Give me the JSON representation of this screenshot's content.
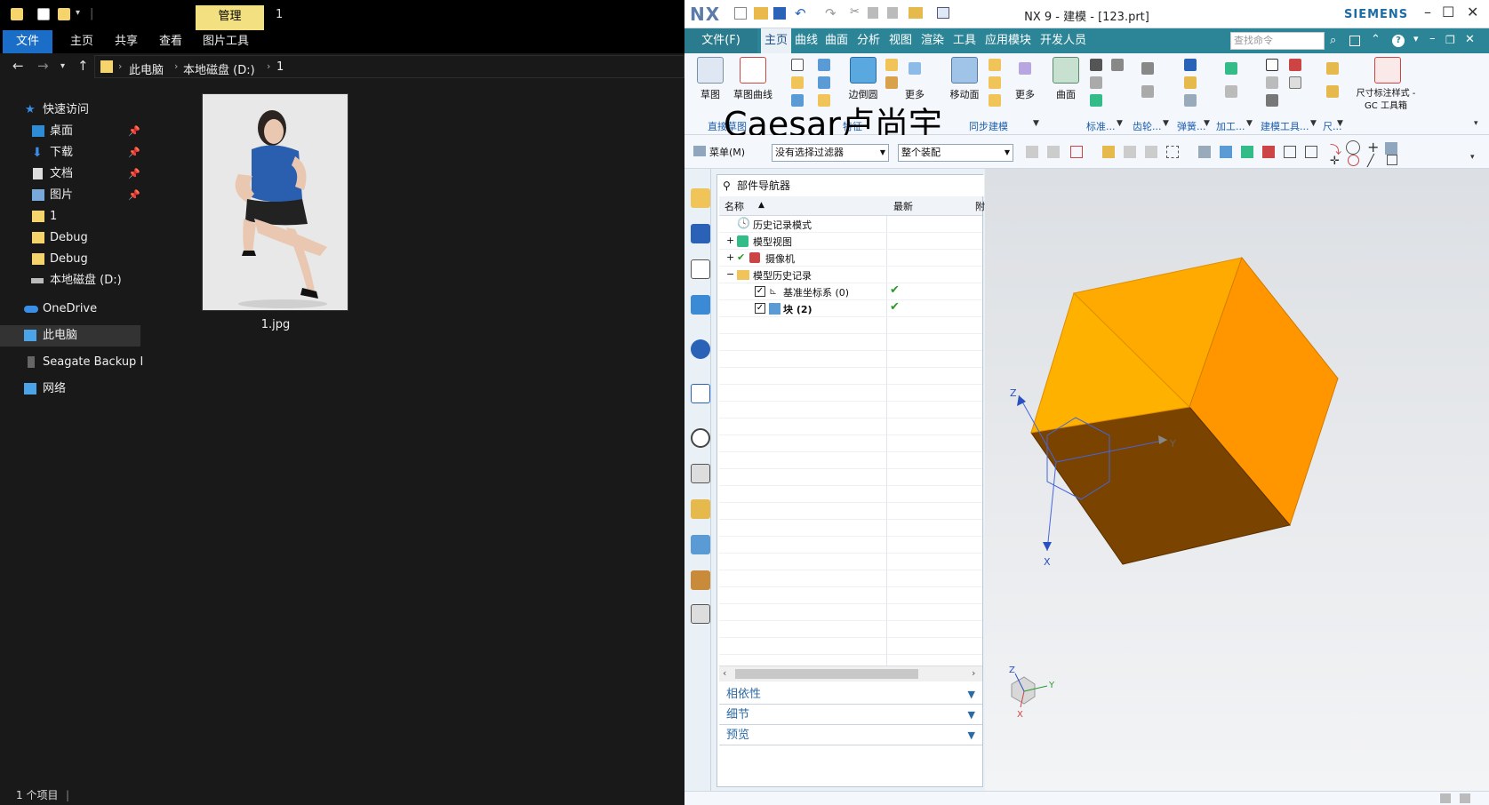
{
  "explorer": {
    "manage_tab": "管理",
    "window_title": "1",
    "tabs": [
      "文件",
      "主页",
      "共享",
      "查看",
      "图片工具"
    ],
    "breadcrumb": [
      "此电脑",
      "本地磁盘 (D:)",
      "1"
    ],
    "nav": [
      {
        "label": "快速访问",
        "icon": "star-icon"
      },
      {
        "label": "桌面",
        "icon": "desktop-icon",
        "pinned": true
      },
      {
        "label": "下载",
        "icon": "download-icon",
        "pinned": true
      },
      {
        "label": "文档",
        "icon": "document-icon",
        "pinned": true
      },
      {
        "label": "图片",
        "icon": "pictures-icon",
        "pinned": true
      },
      {
        "label": "1",
        "icon": "folder-icon"
      },
      {
        "label": "Debug",
        "icon": "folder-icon"
      },
      {
        "label": "Debug",
        "icon": "folder-icon"
      },
      {
        "label": "本地磁盘 (D:)",
        "icon": "drive-icon"
      },
      {
        "label": "OneDrive",
        "icon": "cloud-icon"
      },
      {
        "label": "此电脑",
        "icon": "computer-icon",
        "selected": true
      },
      {
        "label": "Seagate Backup Plu",
        "icon": "external-drive-icon"
      },
      {
        "label": "网络",
        "icon": "network-icon"
      }
    ],
    "file": {
      "name": "1.jpg"
    },
    "status": "1 个项目"
  },
  "nx": {
    "logo": "NX",
    "title": "NX 9 - 建模 - [123.prt]",
    "brand": "SIEMENS",
    "file_tab": "文件(F)",
    "tabs": [
      "主页",
      "曲线",
      "曲面",
      "分析",
      "视图",
      "渲染",
      "工具",
      "应用模块",
      "开发人员"
    ],
    "search_placeholder": "查找命令",
    "ribbon": {
      "sketch": "草图",
      "sketch_curve": "草图曲线",
      "edge_blend": "边倒圆",
      "more1": "更多",
      "move_face": "移动面",
      "more2": "更多",
      "surface": "曲面",
      "dimension_style": "尺寸标注样式 -",
      "gc_toolbox": "GC 工具箱",
      "groups": [
        "直接草图",
        "特征",
        "同步建模",
        "标准...",
        "齿轮...",
        "弹簧...",
        "加工...",
        "建模工具...",
        "尺..."
      ]
    },
    "watermark": "Caesar卢尚宇",
    "toolbar": {
      "menu": "菜单(M)",
      "filter": "没有选择过滤器",
      "assembly": "整个装配"
    },
    "navigator": {
      "title": "部件导航器",
      "col_name": "名称",
      "col_latest": "最新",
      "col_extra": "附",
      "rows": [
        {
          "label": "历史记录模式",
          "icon": "clock-icon"
        },
        {
          "label": "模型视图",
          "icon": "views-icon",
          "expander": "+"
        },
        {
          "label": "摄像机",
          "icon": "camera-icon",
          "expander": "+"
        },
        {
          "label": "模型历史记录",
          "icon": "folder-icon",
          "expander": "-"
        },
        {
          "label": "基准坐标系 (0)",
          "icon": "datum-csys-icon",
          "checked": true,
          "latest": true
        },
        {
          "label": "块 (2)",
          "icon": "block-icon",
          "checked": true,
          "latest": true
        }
      ],
      "panes": [
        "相依性",
        "细节",
        "预览"
      ]
    },
    "axes": {
      "x": "X",
      "y": "Y",
      "z": "Z"
    },
    "colors": {
      "cube_top": "#ffaa00",
      "cube_right": "#ff9900",
      "cube_bottom": "#784200",
      "accent": "#2c8597"
    }
  }
}
